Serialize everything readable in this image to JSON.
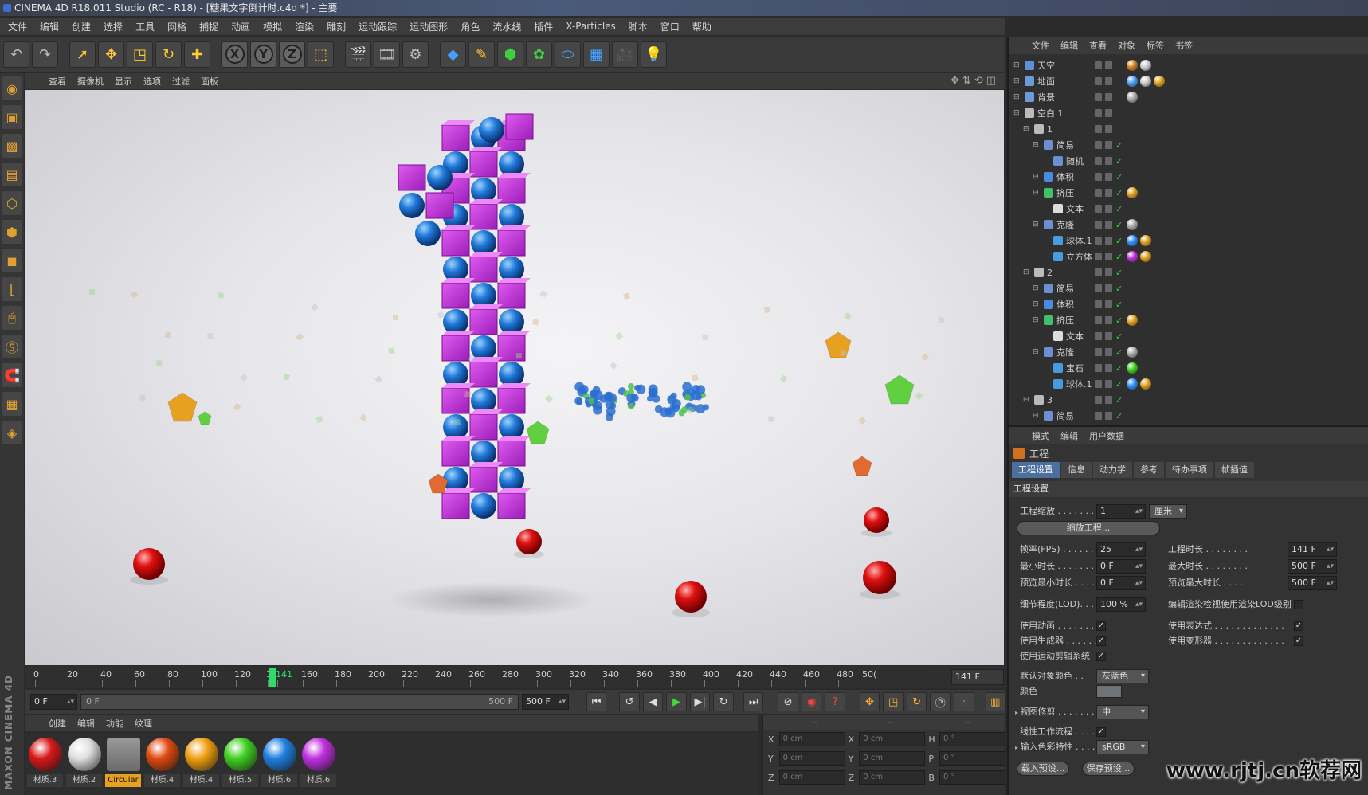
{
  "window": {
    "title": "CINEMA 4D R18.011 Studio (RC - R18) - [糖果文字倒计时.c4d *] - 主要"
  },
  "menubar": [
    "文件",
    "编辑",
    "创建",
    "选择",
    "工具",
    "网格",
    "捕捉",
    "动画",
    "模拟",
    "渲染",
    "雕刻",
    "运动跟踪",
    "运动图形",
    "角色",
    "流水线",
    "插件",
    "X-Particles",
    "脚本",
    "窗口",
    "帮助"
  ],
  "viewport_menu": [
    "查看",
    "摄像机",
    "显示",
    "选项",
    "过滤",
    "面板"
  ],
  "timeline": {
    "ticks": [
      "0",
      "20",
      "40",
      "60",
      "80",
      "100",
      "120",
      "1",
      "141",
      "160",
      "180",
      "200",
      "220",
      "240",
      "260",
      "280",
      "300",
      "320",
      "340",
      "360",
      "380",
      "400",
      "420",
      "440",
      "460",
      "480",
      "50("
    ],
    "current_frame": "141 F"
  },
  "transport": {
    "start_field": "0 F",
    "slider_left": "0 F",
    "slider_right": "500 F",
    "end_field": "500 F"
  },
  "material_menu": [
    "创建",
    "编辑",
    "功能",
    "纹理"
  ],
  "materials": [
    {
      "label": "材质.3",
      "color": "#d81818"
    },
    {
      "label": "材质.2",
      "color": "#e0e0e0"
    },
    {
      "label": "Circular",
      "color": "#8a8a8a"
    },
    {
      "label": "材质.4",
      "color": "#e04a10"
    },
    {
      "label": "材质.4",
      "color": "#f0a010"
    },
    {
      "label": "材质.5",
      "color": "#40d020"
    },
    {
      "label": "材质.6",
      "color": "#2080e0"
    },
    {
      "label": "材质.6",
      "color": "#c030e0"
    }
  ],
  "coords": {
    "headers": [
      "--",
      "--",
      "--"
    ],
    "rows": [
      {
        "a": "X",
        "av": "0 cm",
        "b": "X",
        "bv": "0 cm",
        "c": "H",
        "cv": "0 °"
      },
      {
        "a": "Y",
        "av": "0 cm",
        "b": "Y",
        "bv": "0 cm",
        "c": "P",
        "cv": "0 °"
      },
      {
        "a": "Z",
        "av": "0 cm",
        "b": "Z",
        "bv": "0 cm",
        "c": "B",
        "cv": "0 °"
      }
    ]
  },
  "object_menu": [
    "文件",
    "编辑",
    "查看",
    "对象",
    "标签",
    "书签"
  ],
  "objects": [
    {
      "name": "天空",
      "indent": 0,
      "icon": "#5e8fd8"
    },
    {
      "name": "地面",
      "indent": 0,
      "icon": "#6e9ad8"
    },
    {
      "name": "背景",
      "indent": 0,
      "icon": "#6e9ad8"
    },
    {
      "name": "空白.1",
      "indent": 0,
      "icon": "#bbbbbb"
    },
    {
      "name": "1",
      "indent": 1,
      "icon": "#bbbbbb"
    },
    {
      "name": "简易",
      "indent": 2,
      "icon": "#6b8fd0"
    },
    {
      "name": "随机",
      "indent": 3,
      "icon": "#6b8fd0"
    },
    {
      "name": "体积",
      "indent": 2,
      "icon": "#4a8ae0"
    },
    {
      "name": "挤压",
      "indent": 2,
      "icon": "#3fc06a"
    },
    {
      "name": "文本",
      "indent": 3,
      "icon": "#dddddd"
    },
    {
      "name": "克隆",
      "indent": 2,
      "icon": "#6b8fd0"
    },
    {
      "name": "球体.1",
      "indent": 3,
      "icon": "#4a9ae0"
    },
    {
      "name": "立方体",
      "indent": 3,
      "icon": "#4a9ae0"
    },
    {
      "name": "2",
      "indent": 1,
      "icon": "#bbbbbb"
    },
    {
      "name": "简易",
      "indent": 2,
      "icon": "#6b8fd0"
    },
    {
      "name": "体积",
      "indent": 2,
      "icon": "#4a8ae0"
    },
    {
      "name": "挤压",
      "indent": 2,
      "icon": "#3fc06a"
    },
    {
      "name": "文本",
      "indent": 3,
      "icon": "#dddddd"
    },
    {
      "name": "克隆",
      "indent": 2,
      "icon": "#6b8fd0"
    },
    {
      "name": "宝石",
      "indent": 3,
      "icon": "#4a9ae0"
    },
    {
      "name": "球体.1",
      "indent": 3,
      "icon": "#4a9ae0"
    },
    {
      "name": "3",
      "indent": 1,
      "icon": "#bbbbbb"
    },
    {
      "name": "简易",
      "indent": 2,
      "icon": "#6b8fd0"
    }
  ],
  "attr_menu": [
    "模式",
    "编辑",
    "用户数据"
  ],
  "attr": {
    "title": "工程",
    "tabs": [
      "工程设置",
      "信息",
      "动力学",
      "参考",
      "待办事项",
      "帧插值"
    ],
    "section": "工程设置",
    "scale_label": "工程缩放 . . . . . . .",
    "scale_value": "1",
    "scale_unit": "厘米",
    "scale_button": "缩放工程...",
    "fps_label": "帧率(FPS) . . . . . .",
    "fps_value": "25",
    "length_label": "工程时长 . . . . . . . .",
    "length_value": "141 F",
    "min_label": "最小时长 . . . . . . . .",
    "min_value": "0 F",
    "max_label": "最大时长 . . . . . . . .",
    "max_value": "500 F",
    "pmin_label": "预览最小时长 . . . .",
    "pmin_value": "0 F",
    "pmax_label": "预览最大时长 . . . .",
    "pmax_value": "500 F",
    "lod_label": "细节程度(LOD). . . .",
    "lod_value": "100 %",
    "lod_render_label": "编辑渲染检视使用渲染LOD级别",
    "use_anim": "使用动画 . . . . . . . .",
    "use_expr": "使用表达式 . . . . . . . . . . . . .",
    "use_gen": "使用生成器 . . . . . .",
    "use_deform": "使用变形器 . . . . . . . . . . . . .",
    "use_motion": "使用运动剪辑系统",
    "obj_color_label": "默认对象颜色 . .",
    "obj_color_value": "灰蓝色",
    "color_label": "颜色",
    "clip_label": "视图修剪 . . . . . . . .",
    "clip_value": "中",
    "linear_label": "线性工作流程 . . . .",
    "input_color_label": "输入色彩特性 . . . .",
    "input_color_value": "sRGB",
    "btn_load": "载入预设...",
    "btn_save": "保存预设..."
  },
  "brand_vertical": "MAXON CINEMA 4D",
  "watermark": "www.rjtj.cn软荐网"
}
